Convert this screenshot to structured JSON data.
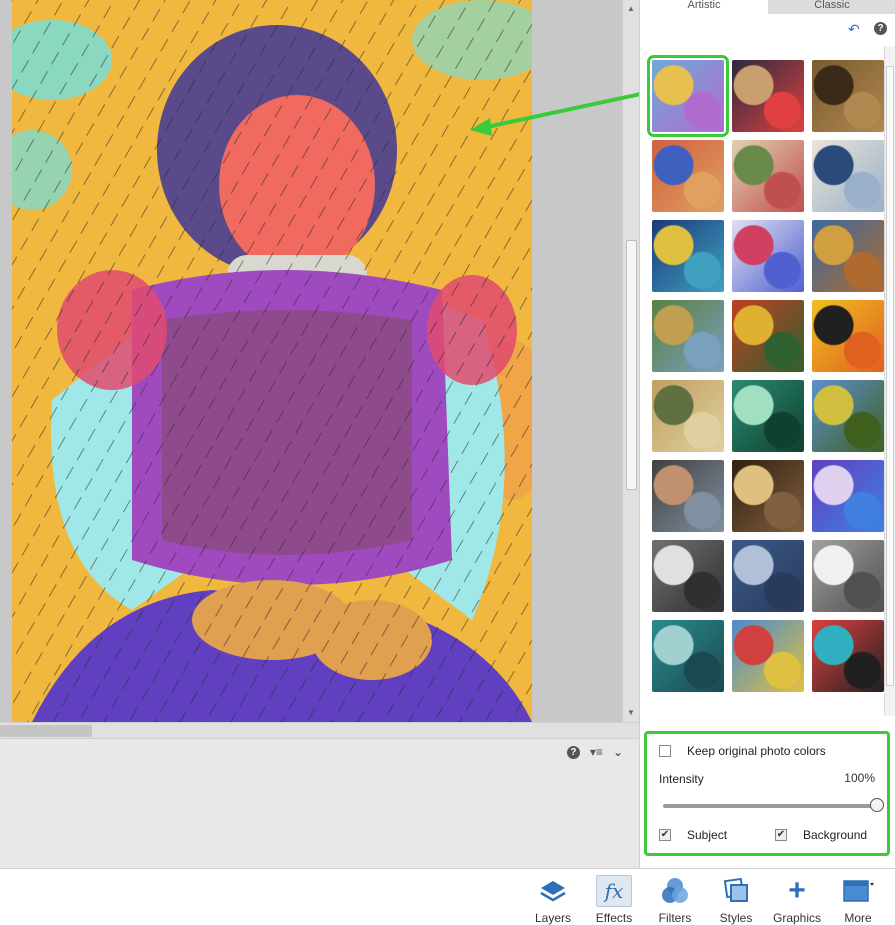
{
  "panel": {
    "tabs": [
      "Artistic",
      "Classic"
    ],
    "help_icon": "question-circle-icon",
    "reset_icon": "undo-arrow-icon"
  },
  "thumbnails": [
    {
      "name": "abstract-portrait",
      "colors": [
        "#6fa9d6",
        "#e8c050",
        "#b06bd0"
      ]
    },
    {
      "name": "cubist-faces",
      "colors": [
        "#2a2a40",
        "#c8a070",
        "#e04040"
      ]
    },
    {
      "name": "mona-lisa",
      "colors": [
        "#7a5a30",
        "#3a2a18",
        "#b08850"
      ]
    },
    {
      "name": "colorful-woman",
      "colors": [
        "#d06040",
        "#4060c0",
        "#e0a060"
      ]
    },
    {
      "name": "village-painting",
      "colors": [
        "#e0d0b0",
        "#6a8a4a",
        "#c05050"
      ]
    },
    {
      "name": "great-wave",
      "colors": [
        "#e8e4d8",
        "#2a4a7a",
        "#9ab0c8"
      ]
    },
    {
      "name": "night-dancers",
      "colors": [
        "#1a3a7a",
        "#e0c040",
        "#40a0c0"
      ]
    },
    {
      "name": "colorful-dog",
      "colors": [
        "#e0e0f0",
        "#d04060",
        "#5060d0"
      ]
    },
    {
      "name": "van-gogh-portrait",
      "colors": [
        "#3a6aa0",
        "#d0a040",
        "#b06a30"
      ]
    },
    {
      "name": "olive-trees",
      "colors": [
        "#5a8040",
        "#c0a050",
        "#7aa0c0"
      ]
    },
    {
      "name": "cafe-terrace",
      "colors": [
        "#c04020",
        "#e0b030",
        "#306030"
      ]
    },
    {
      "name": "penguin-abstract",
      "colors": [
        "#f0c020",
        "#202020",
        "#e06020"
      ]
    },
    {
      "name": "golden-swirl",
      "colors": [
        "#c0a060",
        "#607040",
        "#e0d0a0"
      ]
    },
    {
      "name": "teal-waves",
      "colors": [
        "#2a8a70",
        "#a0e0c0",
        "#104030"
      ]
    },
    {
      "name": "wheat-field",
      "colors": [
        "#5a90d0",
        "#d0c040",
        "#406020"
      ]
    },
    {
      "name": "family-photo",
      "colors": [
        "#404040",
        "#c09070",
        "#8090a0"
      ]
    },
    {
      "name": "concert-stage",
      "colors": [
        "#302010",
        "#e0c080",
        "#806040"
      ]
    },
    {
      "name": "purple-swirl",
      "colors": [
        "#6040c0",
        "#e0d0f0",
        "#4080e0"
      ]
    },
    {
      "name": "cubist-dancer",
      "colors": [
        "#707070",
        "#e0e0e0",
        "#303030"
      ]
    },
    {
      "name": "ballerinas",
      "colors": [
        "#3a5a8a",
        "#b0c0d8",
        "#2a3a5a"
      ]
    },
    {
      "name": "city-sketch",
      "colors": [
        "#a0a0a0",
        "#f0f0f0",
        "#505050"
      ]
    },
    {
      "name": "teal-texture",
      "colors": [
        "#2a8a90",
        "#a0d0d0",
        "#1a4a50"
      ]
    },
    {
      "name": "red-barn-field",
      "colors": [
        "#4a8ad0",
        "#d04040",
        "#e0c040"
      ]
    },
    {
      "name": "raccoon-pop",
      "colors": [
        "#e04040",
        "#30b0c0",
        "#202020"
      ]
    }
  ],
  "settings": {
    "keep_colors_label": "Keep original photo colors",
    "keep_colors_checked": false,
    "intensity_label": "Intensity",
    "intensity_value": "100%",
    "intensity_fraction": 1.0,
    "subject_label": "Subject",
    "subject_checked": true,
    "background_label": "Background",
    "background_checked": true
  },
  "toolbar": {
    "layers": "Layers",
    "effects": "Effects",
    "filters": "Filters",
    "styles": "Styles",
    "graphics": "Graphics",
    "more": "More"
  },
  "accent_color": "#3acb3a"
}
